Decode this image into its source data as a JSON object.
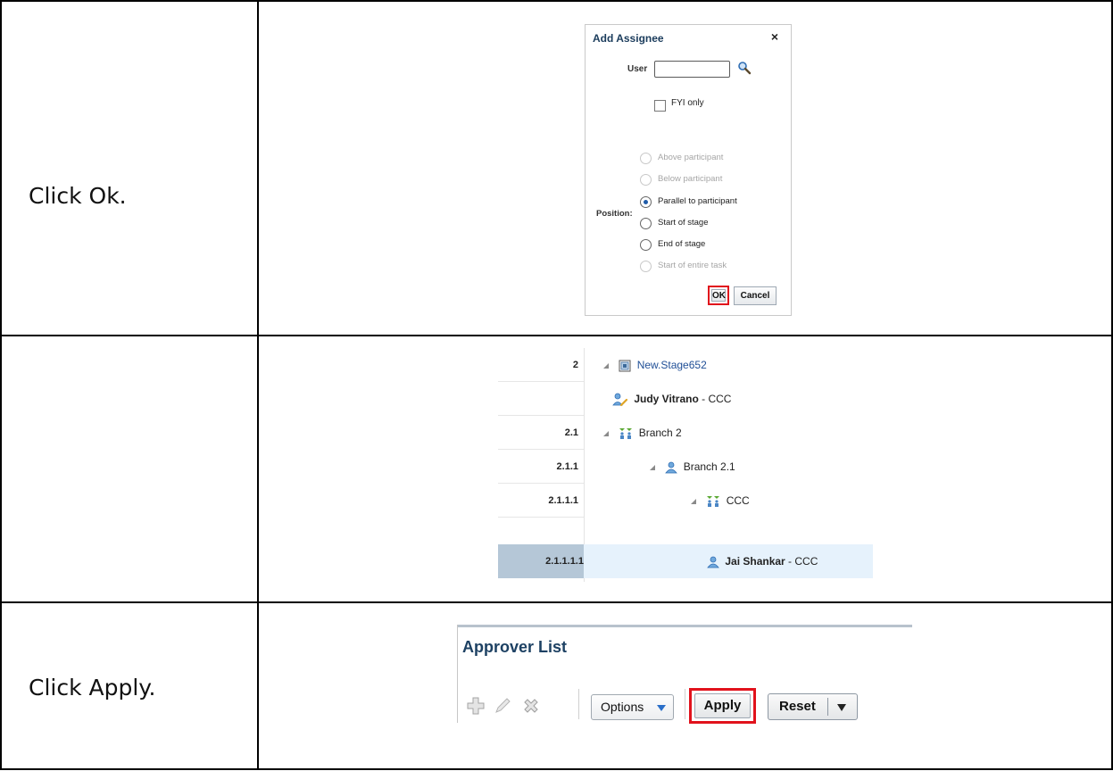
{
  "steps": [
    {
      "instruction": "Click Ok."
    },
    {
      "instruction": ""
    },
    {
      "instruction": "Click Apply."
    }
  ],
  "add_assignee_dialog": {
    "title": "Add Assignee",
    "close_glyph": "×",
    "user_label": "User",
    "user_value": "",
    "fyi_label": "FYI only",
    "position_label": "Position:",
    "position_options": [
      {
        "label": "Above participant",
        "enabled": false,
        "selected": false
      },
      {
        "label": "Below participant",
        "enabled": false,
        "selected": false
      },
      {
        "label": "Parallel to participant",
        "enabled": true,
        "selected": true
      },
      {
        "label": "Start of stage",
        "enabled": true,
        "selected": false
      },
      {
        "label": "End of stage",
        "enabled": true,
        "selected": false
      },
      {
        "label": "Start of entire task",
        "enabled": false,
        "selected": false
      }
    ],
    "ok_label": "OK",
    "cancel_label": "Cancel",
    "highlight_color": "#e1121c"
  },
  "hierarchy": {
    "rows": [
      {
        "number": "2",
        "name": "New.Stage652",
        "suffix": "",
        "kind": "stage"
      },
      {
        "number": "",
        "name": "Judy Vitrano",
        "suffix": " - CCC",
        "kind": "participant-edit"
      },
      {
        "number": "2.1",
        "name": "Branch 2",
        "suffix": "",
        "kind": "parallel"
      },
      {
        "number": "2.1.1",
        "name": "Branch 2.1",
        "suffix": "",
        "kind": "user"
      },
      {
        "number": "2.1.1.1",
        "name": "CCC",
        "suffix": "",
        "kind": "parallel"
      },
      {
        "number": "2.1.1.1.1",
        "name": "Jai Shankar",
        "suffix": " - CCC",
        "kind": "user-selected"
      }
    ]
  },
  "approver_list": {
    "title": "Approver List",
    "options_label": "Options",
    "apply_label": "Apply",
    "reset_label": "Reset",
    "title_color": "#1d4163"
  }
}
